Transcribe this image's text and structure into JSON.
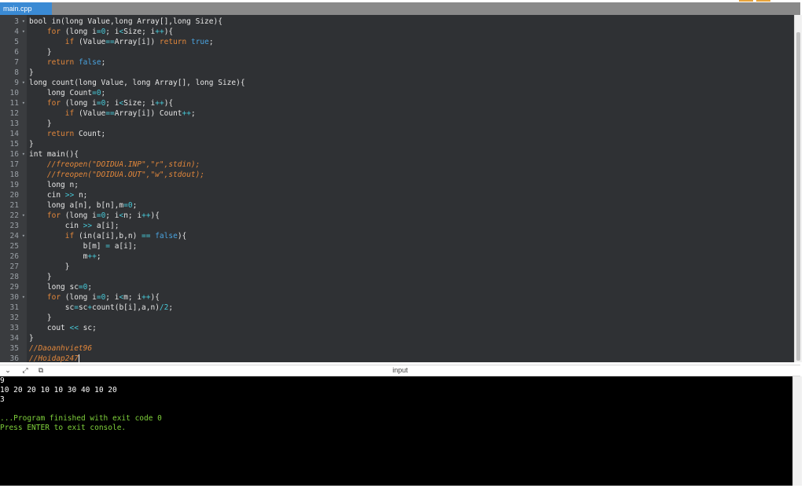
{
  "tab": {
    "label": "main.cpp"
  },
  "editor": {
    "lines": [
      {
        "n": "3",
        "fold": true,
        "tokens": [
          [
            "txt",
            "bool in(long Value,long Array[],long Size){"
          ]
        ]
      },
      {
        "n": "4",
        "fold": true,
        "tokens": [
          [
            "txt",
            "    "
          ],
          [
            "kw",
            "for"
          ],
          [
            "txt",
            " (long i"
          ],
          [
            "op",
            "="
          ],
          [
            "num",
            "0"
          ],
          [
            "txt",
            "; i"
          ],
          [
            "op",
            "<"
          ],
          [
            "txt",
            "Size; i"
          ],
          [
            "op",
            "++"
          ],
          [
            "txt",
            "){"
          ]
        ]
      },
      {
        "n": "5",
        "fold": false,
        "tokens": [
          [
            "txt",
            "        "
          ],
          [
            "kw",
            "if"
          ],
          [
            "txt",
            " (Value"
          ],
          [
            "op",
            "=="
          ],
          [
            "txt",
            "Array[i]) "
          ],
          [
            "kw",
            "return"
          ],
          [
            "txt",
            " "
          ],
          [
            "bool",
            "true"
          ],
          [
            "txt",
            ";"
          ]
        ]
      },
      {
        "n": "6",
        "fold": false,
        "tokens": [
          [
            "txt",
            "    }"
          ]
        ]
      },
      {
        "n": "7",
        "fold": false,
        "tokens": [
          [
            "txt",
            "    "
          ],
          [
            "kw",
            "return"
          ],
          [
            "txt",
            " "
          ],
          [
            "bool",
            "false"
          ],
          [
            "txt",
            ";"
          ]
        ]
      },
      {
        "n": "8",
        "fold": false,
        "tokens": [
          [
            "txt",
            "}"
          ]
        ]
      },
      {
        "n": "9",
        "fold": true,
        "tokens": [
          [
            "txt",
            "long count(long Value, long Array[], long Size){"
          ]
        ]
      },
      {
        "n": "10",
        "fold": false,
        "tokens": [
          [
            "txt",
            "    long Count"
          ],
          [
            "op",
            "="
          ],
          [
            "num",
            "0"
          ],
          [
            "txt",
            ";"
          ]
        ]
      },
      {
        "n": "11",
        "fold": true,
        "tokens": [
          [
            "txt",
            "    "
          ],
          [
            "kw",
            "for"
          ],
          [
            "txt",
            " (long i"
          ],
          [
            "op",
            "="
          ],
          [
            "num",
            "0"
          ],
          [
            "txt",
            "; i"
          ],
          [
            "op",
            "<"
          ],
          [
            "txt",
            "Size; i"
          ],
          [
            "op",
            "++"
          ],
          [
            "txt",
            "){"
          ]
        ]
      },
      {
        "n": "12",
        "fold": false,
        "tokens": [
          [
            "txt",
            "        "
          ],
          [
            "kw",
            "if"
          ],
          [
            "txt",
            " (Value"
          ],
          [
            "op",
            "=="
          ],
          [
            "txt",
            "Array[i]) Count"
          ],
          [
            "op",
            "++"
          ],
          [
            "txt",
            ";"
          ]
        ]
      },
      {
        "n": "13",
        "fold": false,
        "tokens": [
          [
            "txt",
            "    }"
          ]
        ]
      },
      {
        "n": "14",
        "fold": false,
        "tokens": [
          [
            "txt",
            "    "
          ],
          [
            "kw",
            "return"
          ],
          [
            "txt",
            " Count;"
          ]
        ]
      },
      {
        "n": "15",
        "fold": false,
        "tokens": [
          [
            "txt",
            "}"
          ]
        ]
      },
      {
        "n": "16",
        "fold": true,
        "tokens": [
          [
            "txt",
            "int main(){"
          ]
        ]
      },
      {
        "n": "17",
        "fold": false,
        "tokens": [
          [
            "txt",
            "    "
          ],
          [
            "cm",
            "//freopen(\"DOIDUA.INP\",\"r\",stdin);"
          ]
        ]
      },
      {
        "n": "18",
        "fold": false,
        "tokens": [
          [
            "txt",
            "    "
          ],
          [
            "cm",
            "//freopen(\"DOIDUA.OUT\",\"w\",stdout);"
          ]
        ]
      },
      {
        "n": "19",
        "fold": false,
        "tokens": [
          [
            "txt",
            "    long n;"
          ]
        ]
      },
      {
        "n": "20",
        "fold": false,
        "tokens": [
          [
            "txt",
            "    cin "
          ],
          [
            "op",
            ">>"
          ],
          [
            "txt",
            " n;"
          ]
        ]
      },
      {
        "n": "21",
        "fold": false,
        "tokens": [
          [
            "txt",
            "    long a[n], b[n],m"
          ],
          [
            "op",
            "="
          ],
          [
            "num",
            "0"
          ],
          [
            "txt",
            ";"
          ]
        ]
      },
      {
        "n": "22",
        "fold": true,
        "tokens": [
          [
            "txt",
            "    "
          ],
          [
            "kw",
            "for"
          ],
          [
            "txt",
            " (long i"
          ],
          [
            "op",
            "="
          ],
          [
            "num",
            "0"
          ],
          [
            "txt",
            "; i"
          ],
          [
            "op",
            "<"
          ],
          [
            "txt",
            "n; i"
          ],
          [
            "op",
            "++"
          ],
          [
            "txt",
            "){"
          ]
        ]
      },
      {
        "n": "23",
        "fold": false,
        "tokens": [
          [
            "txt",
            "        cin "
          ],
          [
            "op",
            ">>"
          ],
          [
            "txt",
            " a[i];"
          ]
        ]
      },
      {
        "n": "24",
        "fold": true,
        "tokens": [
          [
            "txt",
            "        "
          ],
          [
            "kw",
            "if"
          ],
          [
            "txt",
            " (in(a[i],b,n) "
          ],
          [
            "op",
            "=="
          ],
          [
            "txt",
            " "
          ],
          [
            "bool",
            "false"
          ],
          [
            "txt",
            "){"
          ]
        ]
      },
      {
        "n": "25",
        "fold": false,
        "tokens": [
          [
            "txt",
            "            b[m] "
          ],
          [
            "op",
            "="
          ],
          [
            "txt",
            " a[i];"
          ]
        ]
      },
      {
        "n": "26",
        "fold": false,
        "tokens": [
          [
            "txt",
            "            m"
          ],
          [
            "op",
            "++"
          ],
          [
            "txt",
            ";"
          ]
        ]
      },
      {
        "n": "27",
        "fold": false,
        "tokens": [
          [
            "txt",
            "        }"
          ]
        ]
      },
      {
        "n": "28",
        "fold": false,
        "tokens": [
          [
            "txt",
            "    }"
          ]
        ]
      },
      {
        "n": "29",
        "fold": false,
        "tokens": [
          [
            "txt",
            "    long sc"
          ],
          [
            "op",
            "="
          ],
          [
            "num",
            "0"
          ],
          [
            "txt",
            ";"
          ]
        ]
      },
      {
        "n": "30",
        "fold": true,
        "tokens": [
          [
            "txt",
            "    "
          ],
          [
            "kw",
            "for"
          ],
          [
            "txt",
            " (long i"
          ],
          [
            "op",
            "="
          ],
          [
            "num",
            "0"
          ],
          [
            "txt",
            "; i"
          ],
          [
            "op",
            "<"
          ],
          [
            "txt",
            "m; i"
          ],
          [
            "op",
            "++"
          ],
          [
            "txt",
            "){"
          ]
        ]
      },
      {
        "n": "31",
        "fold": false,
        "tokens": [
          [
            "txt",
            "        sc"
          ],
          [
            "op",
            "="
          ],
          [
            "txt",
            "sc"
          ],
          [
            "op",
            "+"
          ],
          [
            "txt",
            "count(b[i],a,n)"
          ],
          [
            "op",
            "/"
          ],
          [
            "num",
            "2"
          ],
          [
            "txt",
            ";"
          ]
        ]
      },
      {
        "n": "32",
        "fold": false,
        "tokens": [
          [
            "txt",
            "    }"
          ]
        ]
      },
      {
        "n": "33",
        "fold": false,
        "tokens": [
          [
            "txt",
            "    cout "
          ],
          [
            "op",
            "<<"
          ],
          [
            "txt",
            " sc;"
          ]
        ]
      },
      {
        "n": "34",
        "fold": false,
        "tokens": [
          [
            "txt",
            "}"
          ]
        ]
      },
      {
        "n": "35",
        "fold": false,
        "tokens": [
          [
            "cm",
            "//Daoanhviet96"
          ]
        ]
      },
      {
        "n": "36",
        "fold": false,
        "tokens": [
          [
            "cm",
            "//Hoidap247"
          ]
        ],
        "caret": true
      }
    ]
  },
  "panel": {
    "title": "input",
    "icons": [
      "chevron-down-icon",
      "expand-icon",
      "copy-icon"
    ]
  },
  "console": {
    "lines": [
      {
        "text": "9",
        "kind": "out"
      },
      {
        "text": "10 20 20 10 10 30 40 10 20",
        "kind": "out"
      },
      {
        "text": "3",
        "kind": "out"
      },
      {
        "text": "",
        "kind": "out"
      },
      {
        "text": "...Program finished with exit code 0",
        "kind": "msg"
      },
      {
        "text": "Press ENTER to exit console.",
        "kind": "msg"
      }
    ]
  },
  "colors": {
    "editor_bg": "#2f3134",
    "keyword": "#e2873b",
    "operator": "#46c7d6",
    "tab_active": "#3a8ad4",
    "console_msg": "#7fd13b"
  }
}
